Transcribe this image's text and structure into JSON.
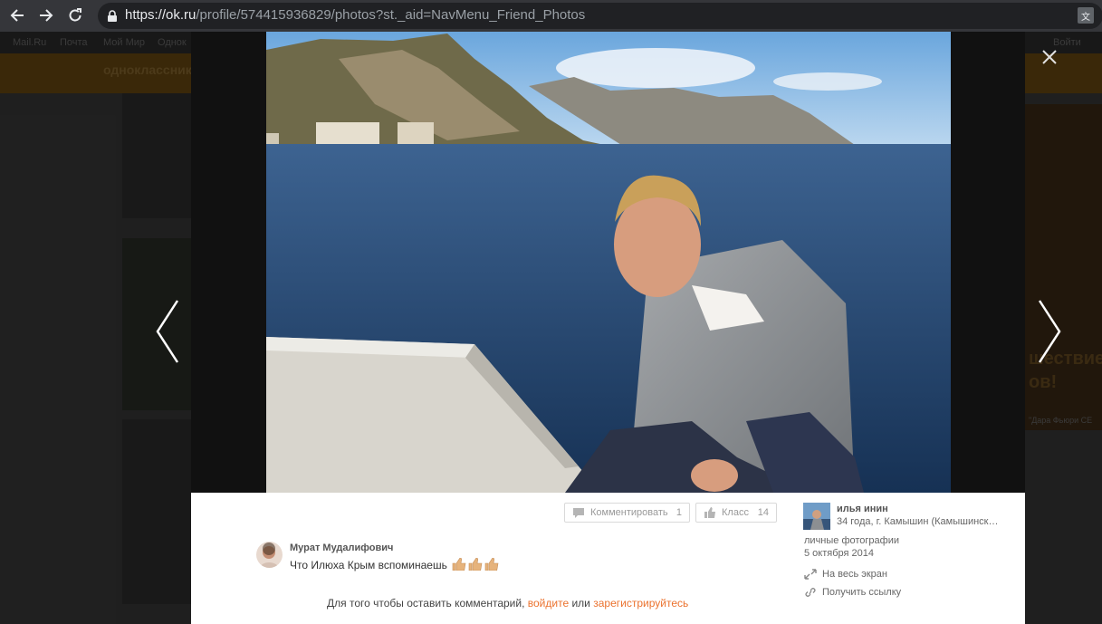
{
  "browser": {
    "url_host": "https://ok.ru",
    "url_path": "/profile/574415936829/photos?st._aid=NavMenu_Friend_Photos",
    "translate_icon": "translate-icon"
  },
  "background": {
    "bookmarks": [
      "Mail.Ru",
      "Почта",
      "Мой Мир",
      "Однок"
    ],
    "bookmark_right": "Войти",
    "brand": "одноклассники",
    "ad_text_1": "шествие",
    "ad_text_2": "ов!",
    "ad_caption": "\"Дара Фьюри CE"
  },
  "viewer": {
    "comment_button": "Комментировать",
    "comment_count": "1",
    "like_button": "Класс",
    "like_count": "14",
    "comment_author": "Мурат Мудалифович",
    "comment_text": "Что Илюха Крым вспоминаешь",
    "login_prefix": "Для того чтобы оставить комментарий,",
    "login_link": "войдите",
    "login_or": "или",
    "register_link": "зарегистрируйтесь",
    "owner_name": "илья инин",
    "owner_info": "34 года, г. Камышин (Камышинск…",
    "album": "личные фотографии",
    "date": "5 октября 2014",
    "fullscreen": "На весь экран",
    "get_link": "Получить ссылку"
  },
  "colors": {
    "accent": "#eb722e",
    "panel": "#ffffff"
  }
}
